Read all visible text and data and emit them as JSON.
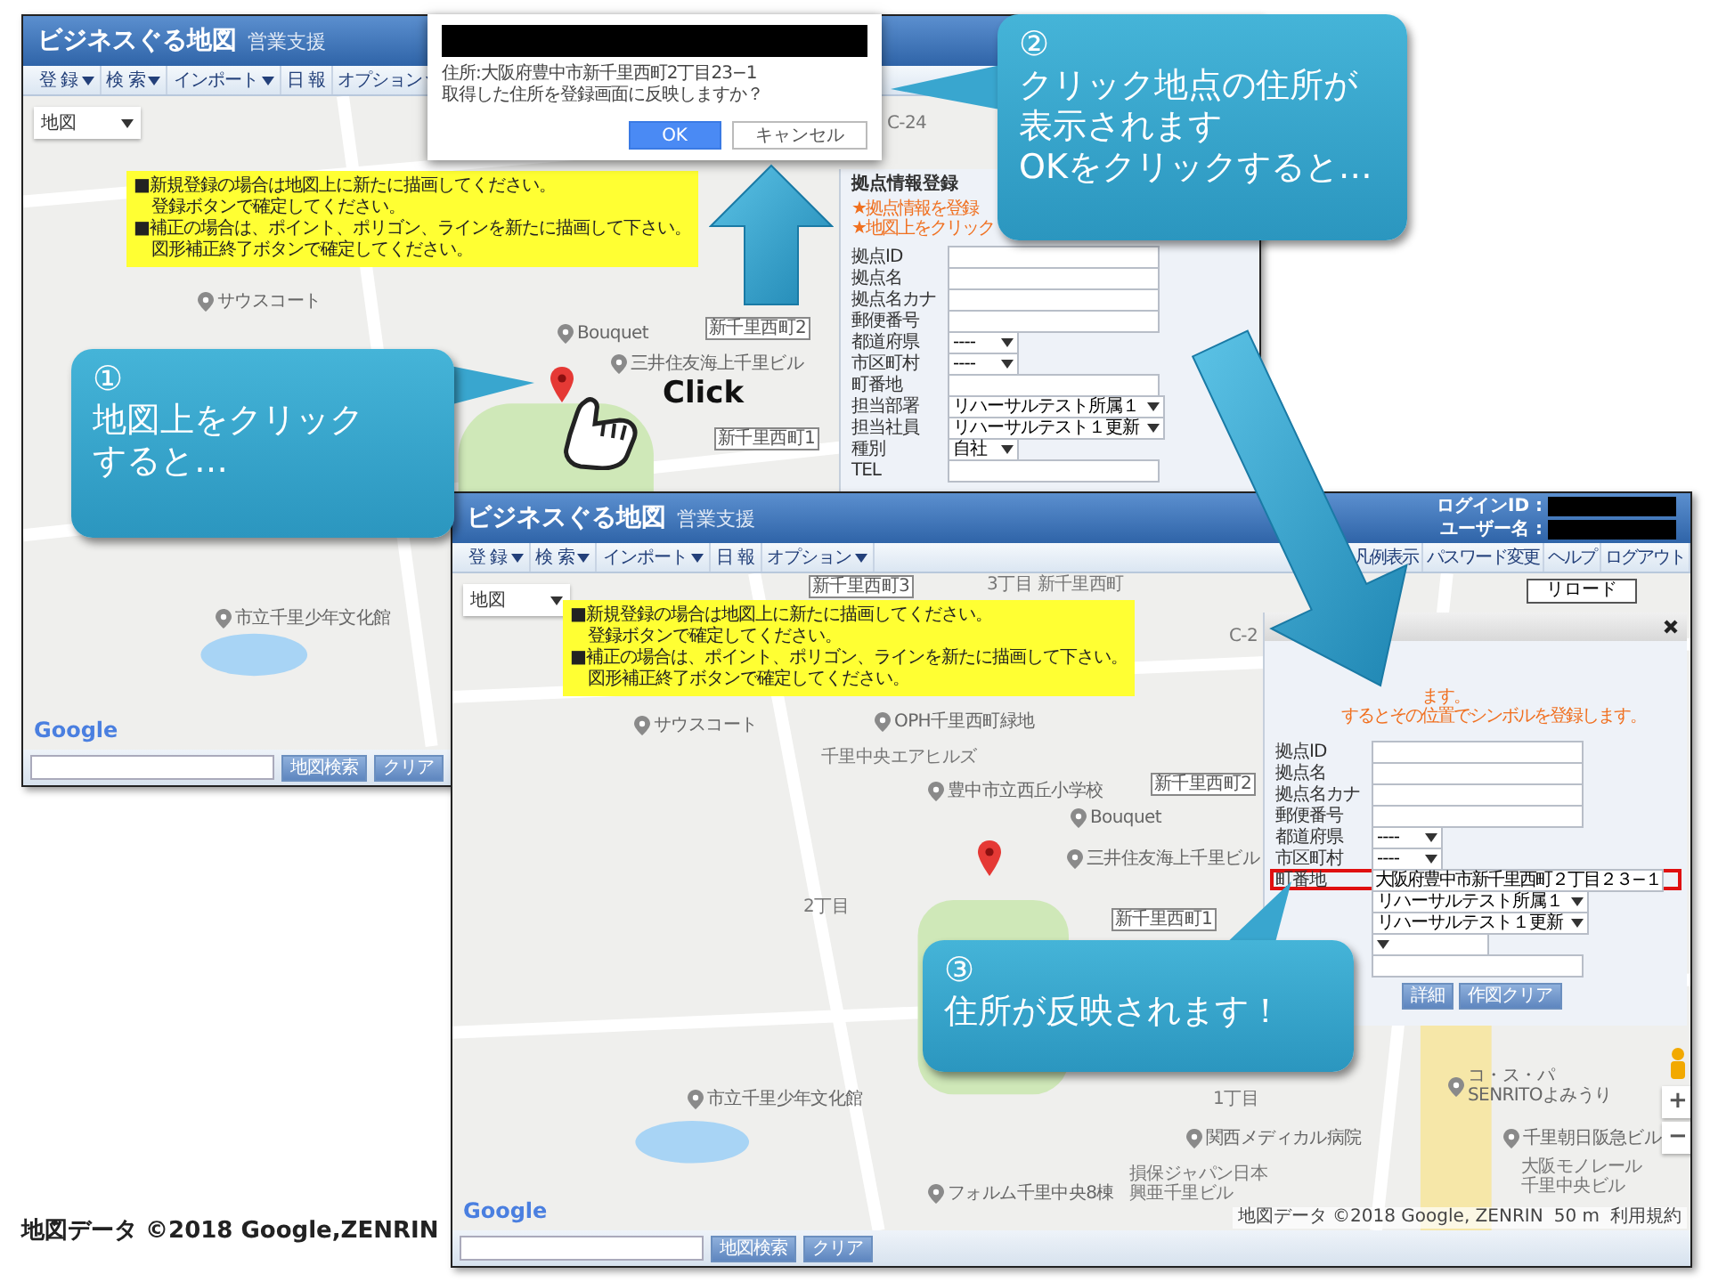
{
  "screens": [
    {
      "title": "ビジネスぐる地図",
      "subtitle": "営業支援",
      "menu": [
        {
          "label": "登 録",
          "dropdown": true
        },
        {
          "label": "検 索",
          "dropdown": true
        },
        {
          "label": "インポート",
          "dropdown": true
        },
        {
          "label": "日 報",
          "dropdown": false
        },
        {
          "label": "オプション",
          "dropdown": true
        }
      ],
      "map_type": "地図",
      "notice": [
        {
          "kind": "bullet",
          "text": "■新規登録の場合は地図上に新たに描画してください。"
        },
        {
          "kind": "continuation",
          "text": "登録ボタンで確定してください。"
        },
        {
          "kind": "bullet",
          "text": "■補正の場合は、ポイント、ポリゴン、ラインを新たに描画して下さい。"
        },
        {
          "kind": "continuation",
          "text": "図形補正終了ボタンで確定してください。"
        }
      ],
      "map_labels": [
        {
          "kind": "area",
          "text": "C-24"
        },
        {
          "kind": "poi",
          "text": "サウスコート"
        },
        {
          "kind": "poi",
          "text": "Bouquet"
        },
        {
          "kind": "station",
          "text": "新千里西町2"
        },
        {
          "kind": "poi",
          "text": "三井住友海上千里ビル"
        },
        {
          "kind": "station",
          "text": "新千里西町1"
        },
        {
          "kind": "poi",
          "text": "市立千里少年文化館"
        }
      ],
      "marker": true,
      "map_logo": "Google",
      "panel": {
        "title": "拠点情報登録",
        "notes": [
          "★拠点情報を登録",
          "★地図上をクリック"
        ],
        "fields": [
          {
            "label": "拠点ID",
            "kind": "text"
          },
          {
            "label": "拠点名",
            "kind": "text"
          },
          {
            "label": "拠点名カナ",
            "kind": "text"
          },
          {
            "label": "郵便番号",
            "kind": "text"
          },
          {
            "label": "都道府県",
            "kind": "select",
            "value": "----"
          },
          {
            "label": "市区町村",
            "kind": "select",
            "value": "----"
          },
          {
            "label": "町番地",
            "kind": "text",
            "highlighted": false
          },
          {
            "label": "担当部署",
            "kind": "select",
            "value": "リハーサルテスト所属１"
          },
          {
            "label": "担当社員",
            "kind": "select",
            "value": "リハーサルテスト１更新"
          },
          {
            "label": "種別",
            "kind": "select",
            "value": "自社"
          },
          {
            "label": "TEL",
            "kind": "text"
          }
        ]
      },
      "search_buttons": [
        "地図検索",
        "クリア"
      ]
    },
    {
      "title": "ビジネスぐる地図",
      "subtitle": "営業支援",
      "account": [
        "ログインID :",
        "ユーザー名 :"
      ],
      "menu": [
        {
          "label": "登 録",
          "dropdown": true
        },
        {
          "label": "検 索",
          "dropdown": true
        },
        {
          "label": "インポート",
          "dropdown": true
        },
        {
          "label": "日 報",
          "dropdown": false
        },
        {
          "label": "オプション",
          "dropdown": true
        }
      ],
      "menu_right": [
        "凡例表示",
        "パスワード変更",
        "ヘルプ",
        "ログアウト"
      ],
      "reload": "リロード",
      "map_type": "地図",
      "notice": [
        {
          "kind": "bullet",
          "text": "■新規登録の場合は地図上に新たに描画してください。"
        },
        {
          "kind": "continuation",
          "text": "登録ボタンで確定してください。"
        },
        {
          "kind": "bullet",
          "text": "■補正の場合は、ポイント、ポリゴン、ラインを新たに描画して下さい。"
        },
        {
          "kind": "continuation",
          "text": "図形補正終了ボタンで確定してください。"
        }
      ],
      "map_labels": [
        {
          "kind": "station",
          "text": "新千里西町3"
        },
        {
          "kind": "area",
          "text": "3丁目 新千里西町"
        },
        {
          "kind": "area",
          "text": "C-2"
        },
        {
          "kind": "poi",
          "text": "サウスコート"
        },
        {
          "kind": "poi",
          "text": "OPH千里西町緑地"
        },
        {
          "kind": "area",
          "text": "千里中央エアヒルズ"
        },
        {
          "kind": "station",
          "text": "新千里西町2"
        },
        {
          "kind": "poi",
          "text": "豊中市立西丘小学校"
        },
        {
          "kind": "poi",
          "text": "Bouquet"
        },
        {
          "kind": "poi",
          "text": "三井住友海上千里ビル"
        },
        {
          "kind": "area",
          "text": "2丁目"
        },
        {
          "kind": "station",
          "text": "新千里西町1"
        },
        {
          "kind": "poi",
          "text": "市立千里少年文化館"
        },
        {
          "kind": "area",
          "text": "1丁目"
        },
        {
          "kind": "poi",
          "text": "コ・ス・パ\nSENRITOよみうり"
        },
        {
          "kind": "poi",
          "text": "関西メディカル病院"
        },
        {
          "kind": "poi",
          "text": "千里朝日阪急ビル"
        },
        {
          "kind": "area",
          "text": "損保ジャパン日本興亜千里ビル"
        },
        {
          "kind": "area",
          "text": "大阪モノレール千里中央ビル"
        },
        {
          "kind": "poi",
          "text": "フォルム千里中央8棟"
        }
      ],
      "marker": true,
      "map_logo": "Google",
      "zoom_controls": [
        "+",
        "−"
      ],
      "attribution": [
        "地図データ ©2018 Google, ZENRIN",
        "50 m",
        "利用規約"
      ],
      "panel": {
        "closable": true,
        "notes": [
          "ます。",
          "するとその位置でシンボルを登録します。"
        ],
        "fields": [
          {
            "label": "拠点ID",
            "kind": "text"
          },
          {
            "label": "拠点名",
            "kind": "text"
          },
          {
            "label": "拠点名カナ",
            "kind": "text"
          },
          {
            "label": "郵便番号",
            "kind": "text"
          },
          {
            "label": "都道府県",
            "kind": "select",
            "value": "----"
          },
          {
            "label": "市区町村",
            "kind": "select",
            "value": "----"
          },
          {
            "label": "町番地",
            "kind": "text",
            "value": "大阪府豊中市新千里西町２丁目２３−１",
            "highlighted": true
          },
          {
            "kind": "select",
            "value": "リハーサルテスト所属１"
          },
          {
            "kind": "select",
            "value": "リハーサルテスト１更新"
          },
          {
            "kind": "select"
          },
          {
            "kind": "text"
          }
        ],
        "buttons": [
          "詳細",
          "作図クリア"
        ]
      },
      "search_buttons": [
        "地図検索",
        "クリア"
      ]
    }
  ],
  "dialog": {
    "lines": [
      "住所:大阪府豊中市新千里西町2丁目23−1",
      "取得した住所を登録画面に反映しますか？"
    ],
    "buttons": [
      {
        "label": "OK",
        "primary": true
      },
      {
        "label": "キャンセル",
        "primary": false
      }
    ]
  },
  "click_label": "Click",
  "callouts": [
    {
      "number": "①",
      "lines": [
        "地図上をクリック",
        "すると…"
      ]
    },
    {
      "number": "②",
      "lines": [
        "クリック地点の住所が",
        "表示されます",
        "OKをクリックすると…"
      ]
    },
    {
      "number": "③",
      "lines": [
        "住所が反映されます！"
      ]
    }
  ],
  "caption": "地図データ ©2018 Google,ZENRIN"
}
